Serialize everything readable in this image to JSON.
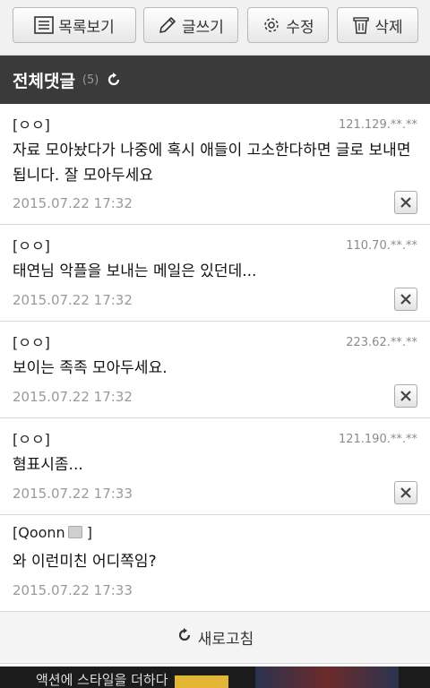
{
  "toolbar": {
    "list_label": "목록보기",
    "write_label": "글쓰기",
    "edit_label": "수정",
    "delete_label": "삭제"
  },
  "section": {
    "title": "전체댓글",
    "count": "(5)"
  },
  "comments": [
    {
      "author": "[ㅇㅇ]",
      "ip": "121.129.**.**",
      "text": "자료 모아놨다가 나중에 혹시 애들이 고소한다하면 글로 보내면됩니다. 잘 모아두세요",
      "date": "2015.07.22 17:32"
    },
    {
      "author": "[ㅇㅇ]",
      "ip": "110.70.**.**",
      "text": "태연님 악플을 보내는 메일은 있던데...",
      "date": "2015.07.22 17:32"
    },
    {
      "author": "[ㅇㅇ]",
      "ip": "223.62.**.**",
      "text": "보이는 족족 모아두세요.",
      "date": "2015.07.22 17:32"
    },
    {
      "author": "[ㅇㅇ]",
      "ip": "121.190.**.**",
      "text": "혐표시좀...",
      "date": "2015.07.22 17:33"
    },
    {
      "author": "[Qoonn",
      "author_suffix": "]",
      "ip": "",
      "text": "와 이런미친 어디쪽임?",
      "date": "2015.07.22 17:33"
    }
  ],
  "refresh_label": "새로고침",
  "ad": {
    "text": "액션에 스타일을 더하다"
  },
  "icons": {
    "list": "list-icon",
    "write": "pencil-icon",
    "edit": "gear-icon",
    "delete": "trash-icon",
    "refresh": "refresh-icon",
    "close": "close-icon"
  },
  "colors": {
    "header_bg": "#3a3a3a",
    "toolbar_bg": "#f1f1f1",
    "ad_accent": "#e2b534"
  }
}
